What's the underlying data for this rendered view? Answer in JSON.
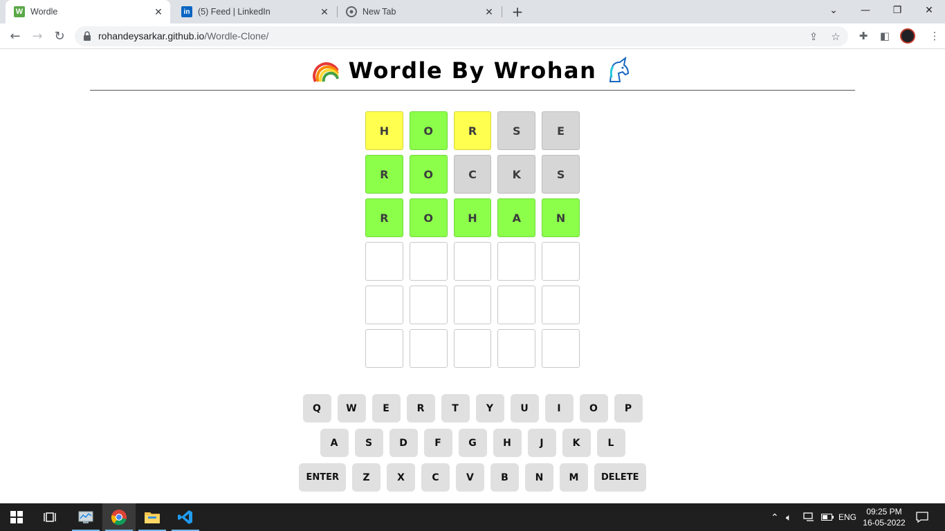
{
  "browser": {
    "tabs": [
      {
        "title": "Wordle",
        "favicon": "W",
        "active": true
      },
      {
        "title": "(5) Feed | LinkedIn",
        "favicon": "in",
        "active": false
      },
      {
        "title": "New Tab",
        "favicon": "chrome",
        "active": false
      }
    ],
    "url_host": "rohandeysarkar.github.io",
    "url_path": "/Wordle-Clone/"
  },
  "page": {
    "title": "Wordle By Wrohan"
  },
  "board": {
    "rows": [
      [
        {
          "letter": "H",
          "state": "present"
        },
        {
          "letter": "O",
          "state": "correct"
        },
        {
          "letter": "R",
          "state": "present"
        },
        {
          "letter": "S",
          "state": "absent"
        },
        {
          "letter": "E",
          "state": "absent"
        }
      ],
      [
        {
          "letter": "R",
          "state": "correct"
        },
        {
          "letter": "O",
          "state": "correct"
        },
        {
          "letter": "C",
          "state": "absent"
        },
        {
          "letter": "K",
          "state": "absent"
        },
        {
          "letter": "S",
          "state": "absent"
        }
      ],
      [
        {
          "letter": "R",
          "state": "correct"
        },
        {
          "letter": "O",
          "state": "correct"
        },
        {
          "letter": "H",
          "state": "correct"
        },
        {
          "letter": "A",
          "state": "correct"
        },
        {
          "letter": "N",
          "state": "correct"
        }
      ],
      [
        {
          "letter": "",
          "state": "empty"
        },
        {
          "letter": "",
          "state": "empty"
        },
        {
          "letter": "",
          "state": "empty"
        },
        {
          "letter": "",
          "state": "empty"
        },
        {
          "letter": "",
          "state": "empty"
        }
      ],
      [
        {
          "letter": "",
          "state": "empty"
        },
        {
          "letter": "",
          "state": "empty"
        },
        {
          "letter": "",
          "state": "empty"
        },
        {
          "letter": "",
          "state": "empty"
        },
        {
          "letter": "",
          "state": "empty"
        }
      ],
      [
        {
          "letter": "",
          "state": "empty"
        },
        {
          "letter": "",
          "state": "empty"
        },
        {
          "letter": "",
          "state": "empty"
        },
        {
          "letter": "",
          "state": "empty"
        },
        {
          "letter": "",
          "state": "empty"
        }
      ]
    ]
  },
  "keyboard": {
    "rows": [
      [
        "Q",
        "W",
        "E",
        "R",
        "T",
        "Y",
        "U",
        "I",
        "O",
        "P"
      ],
      [
        "A",
        "S",
        "D",
        "F",
        "G",
        "H",
        "J",
        "K",
        "L"
      ],
      [
        "ENTER",
        "Z",
        "X",
        "C",
        "V",
        "B",
        "N",
        "M",
        "DELETE"
      ]
    ]
  },
  "taskbar": {
    "language": "ENG",
    "time": "09:25 PM",
    "date": "16-05-2022"
  },
  "colors": {
    "present": "#ffff4f",
    "correct": "#8cff4b",
    "absent": "#d6d6d6",
    "key": "#e0e0e0"
  }
}
